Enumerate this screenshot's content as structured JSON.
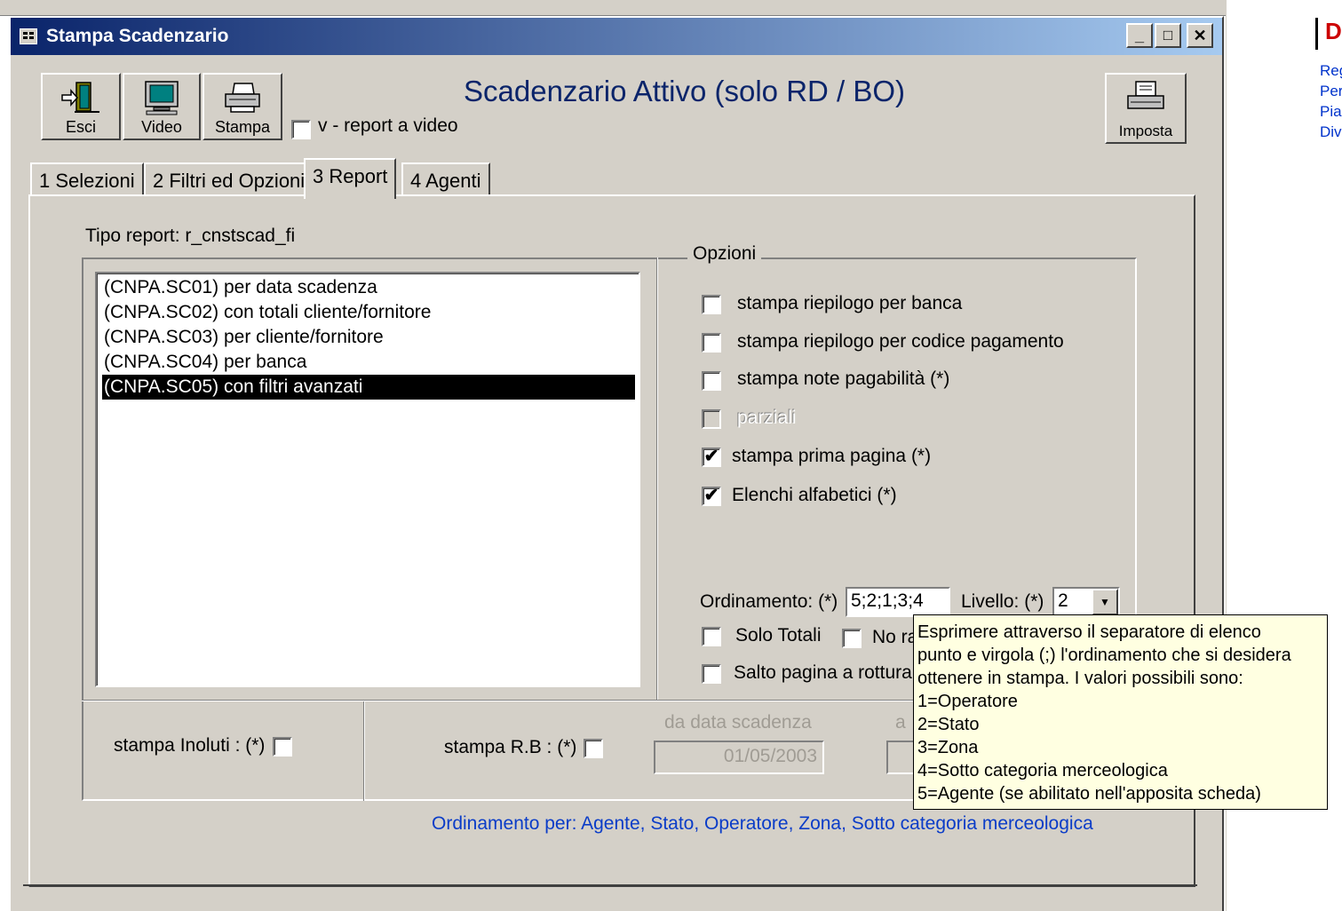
{
  "window": {
    "title": "Stampa Scadenzario",
    "controls": {
      "minimize": "_",
      "maximize": "□",
      "close": "✕"
    }
  },
  "toolbar": {
    "esci": "Esci",
    "video": "Video",
    "stampa": "Stampa",
    "report_video": "v - report a video",
    "imposta": "Imposta"
  },
  "heading": "Scadenzario Attivo (solo RD / BO)",
  "tabs": [
    {
      "label": "1 Selezioni",
      "active": false
    },
    {
      "label": "2 Filtri ed Opzioni",
      "active": false
    },
    {
      "label": "3 Report",
      "active": true
    },
    {
      "label": "4 Agenti",
      "active": false
    }
  ],
  "tipo_report": "Tipo report:  r_cnstscad_fi",
  "reports": [
    {
      "label": "(CNPA.SC01) per data scadenza",
      "selected": false
    },
    {
      "label": "(CNPA.SC02) con totali cliente/fornitore",
      "selected": false
    },
    {
      "label": "(CNPA.SC03) per cliente/fornitore",
      "selected": false
    },
    {
      "label": "(CNPA.SC04) per banca",
      "selected": false
    },
    {
      "label": "(CNPA.SC05) con filtri avanzati",
      "selected": true
    }
  ],
  "options": {
    "legend": "Opzioni",
    "items": [
      {
        "label": "stampa riepilogo per banca",
        "checked": false,
        "enabled": true
      },
      {
        "label": "stampa riepilogo per codice pagamento",
        "checked": false,
        "enabled": true
      },
      {
        "label": "stampa note pagabilità (*)",
        "checked": false,
        "enabled": true
      },
      {
        "label": "parziali",
        "checked": false,
        "enabled": false
      },
      {
        "label": "stampa prima pagina (*)",
        "checked": true,
        "enabled": true
      },
      {
        "label": "Elenchi alfabetici (*)",
        "checked": true,
        "enabled": true
      }
    ],
    "ordinamento_label": "Ordinamento: (*)",
    "ordinamento_value": "5;2;1;3;4",
    "livello_label": "Livello: (*)",
    "livello_value": "2",
    "solo_totali": "Solo Totali",
    "no_ra": "No ra",
    "salto_pagina": "Salto pagina a rottura"
  },
  "bottom": {
    "insoluti_label": "stampa Inoluti : (*)",
    "rb_label": "stampa R.B : (*)",
    "da_data_label": "da data scadenza",
    "da_data_value": "01/05/2003",
    "a_label": "a"
  },
  "ordinamento_per": "Ordinamento per:  Agente,  Stato,  Operatore,  Zona,  Sotto categoria merceologica",
  "tooltip": [
    "Esprimere attraverso il separatore di elenco",
    "punto e virgola (;) l'ordinamento che si desidera",
    "ottenere in stampa. I valori possibili sono:",
    "1=Operatore",
    "2=Stato",
    "3=Zona",
    "4=Sotto categoria merceologica",
    "5=Agente (se abilitato nell'apposita scheda)"
  ],
  "right_panel": {
    "top_letter": "D",
    "links": [
      "Reg",
      "Per",
      "Pia",
      "Div"
    ],
    "accent": "#cc0000",
    "link_color": "#0033cc"
  }
}
